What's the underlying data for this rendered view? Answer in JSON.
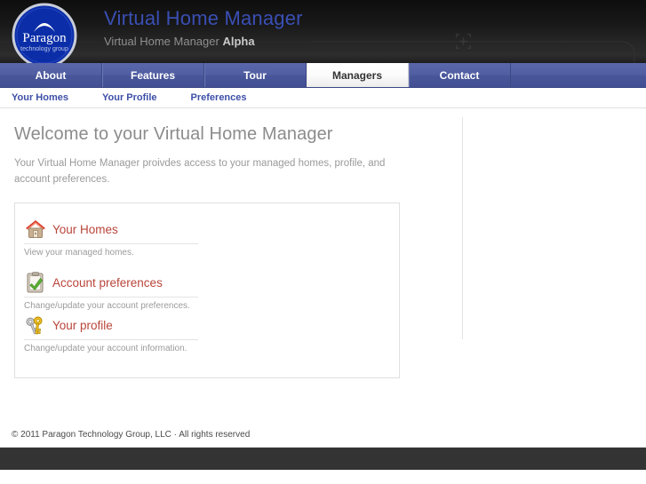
{
  "header": {
    "logo": {
      "name": "paragon-logo",
      "primary_text": "Paragon",
      "secondary_text": "technology group",
      "circle_color": "#1033b5"
    },
    "title": "Virtual Home Manager",
    "subtitle_prefix": "Virtual Home Manager",
    "subtitle_tag": "Alpha",
    "title_color": "#3a4fb4",
    "background_color": "#1a1a1a",
    "decoration_icon": "crosshair-target-icon"
  },
  "nav": {
    "background_color": "#525fa4",
    "active_label": "Managers",
    "items": [
      {
        "label": "About",
        "active": false
      },
      {
        "label": "Features",
        "active": false
      },
      {
        "label": "Tour",
        "active": false
      },
      {
        "label": "Managers",
        "active": true
      },
      {
        "label": "Contact",
        "active": false
      }
    ]
  },
  "subnav": {
    "link_color": "#3d4fa8",
    "items": [
      {
        "label": "Your Homes"
      },
      {
        "label": "Your Profile"
      },
      {
        "label": "Preferences"
      }
    ]
  },
  "main": {
    "page_title": "Welcome to your Virtual Home Manager",
    "intro": "Your Virtual Home Manager proivdes access to your managed homes, profile, and account preferences.",
    "card": {
      "link_color": "#b9453a",
      "shortcuts": [
        {
          "icon": "house-icon",
          "label": "Your Homes",
          "description": "View your managed homes.",
          "column": 0
        },
        {
          "icon": "keys-icon",
          "label": "Your profile",
          "description": "Change/update your account information.",
          "column": 1
        },
        {
          "icon": "clipboard-check-icon",
          "label": "Account preferences",
          "description": "Change/update your account preferences.",
          "column": 0
        }
      ]
    }
  },
  "footer": {
    "copyright": "© 2011 Paragon Technology Group, LLC · All rights reserved",
    "bar_color": "#333333"
  }
}
